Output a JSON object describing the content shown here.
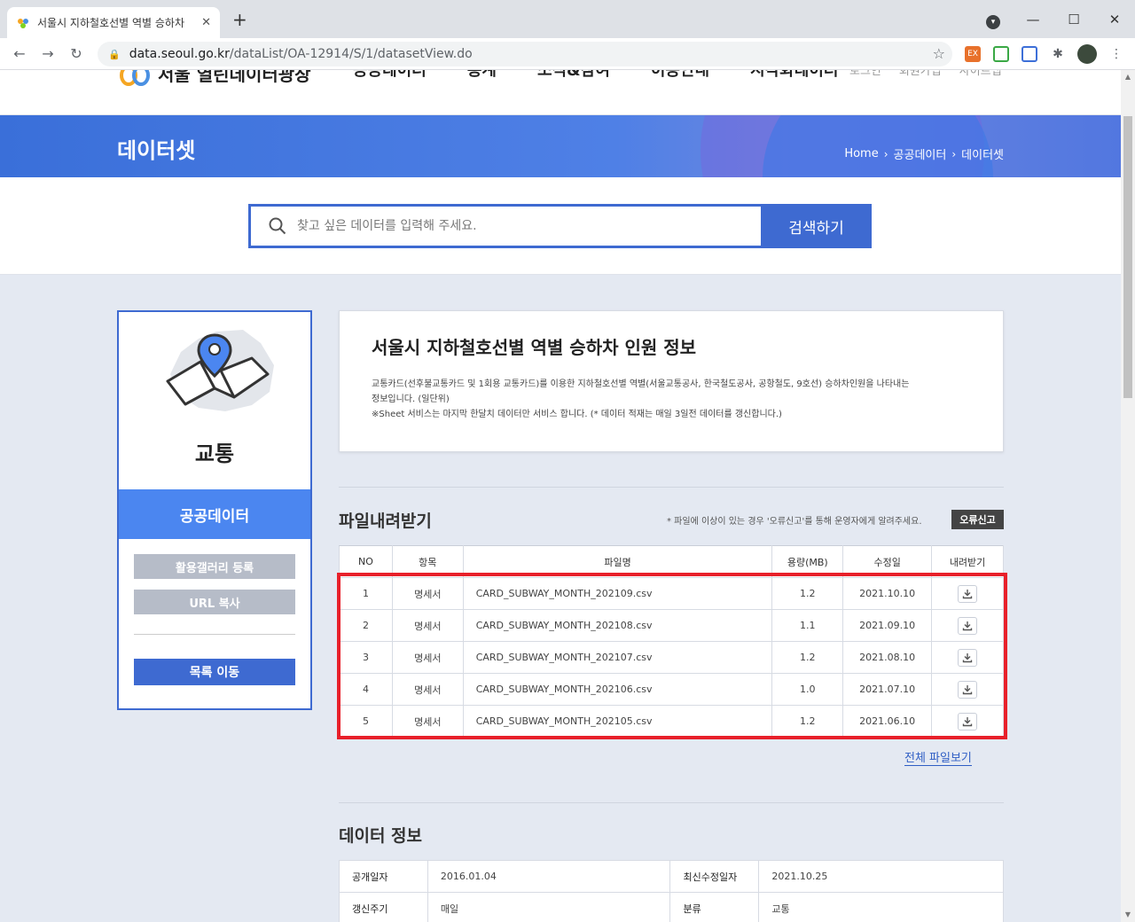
{
  "browser": {
    "tab_title": "서울시 지하철호선별 역별 승하차",
    "url_host": "data.seoul.go.kr",
    "url_path": "/dataList/OA-12914/S/1/datasetView.do"
  },
  "header": {
    "logo_text": "서울 열린데이터광장",
    "nav": [
      "공공데이터",
      "통계",
      "소식&참여",
      "이용안내",
      "시각화데이터"
    ],
    "util": [
      "로그인",
      "회원가입",
      "사이트맵"
    ]
  },
  "banner": {
    "title": "데이터셋",
    "breadcrumb": [
      "Home",
      "공공데이터",
      "데이터셋"
    ]
  },
  "search": {
    "placeholder": "찾고 싶은 데이터를 입력해 주세요.",
    "button": "검색하기"
  },
  "sidebar": {
    "category": "교통",
    "section": "공공데이터",
    "gallery_button": "활용갤러리 등록",
    "url_button": "URL 복사",
    "list_button": "목록 이동"
  },
  "dataset": {
    "title": "서울시 지하철호선별 역별 승하차 인원 정보",
    "description_1": "교통카드(선후불교통카드 및 1회용 교통카드)를 이용한 지하철호선별 역별(서울교통공사, 한국철도공사, 공항철도, 9호선) 승하차인원을 나타내는",
    "description_2": "정보입니다. (일단위)",
    "description_3": "※Sheet 서비스는 마지막 한달치 데이터만 서비스 합니다. (* 데이터 적재는 매일 3일전 데이터를 갱신합니다.)"
  },
  "downloads": {
    "title": "파일내려받기",
    "notice": "* 파일에 이상이 있는 경우 '오류신고'를 통해 운영자에게 알려주세요.",
    "report_button": "오류신고",
    "columns": [
      "NO",
      "항목",
      "파일명",
      "용량(MB)",
      "수정일",
      "내려받기"
    ],
    "rows": [
      {
        "no": "1",
        "type": "명세서",
        "file": "CARD_SUBWAY_MONTH_202109.csv",
        "size": "1.2",
        "date": "2021.10.10"
      },
      {
        "no": "2",
        "type": "명세서",
        "file": "CARD_SUBWAY_MONTH_202108.csv",
        "size": "1.1",
        "date": "2021.09.10"
      },
      {
        "no": "3",
        "type": "명세서",
        "file": "CARD_SUBWAY_MONTH_202107.csv",
        "size": "1.2",
        "date": "2021.08.10"
      },
      {
        "no": "4",
        "type": "명세서",
        "file": "CARD_SUBWAY_MONTH_202106.csv",
        "size": "1.0",
        "date": "2021.07.10"
      },
      {
        "no": "5",
        "type": "명세서",
        "file": "CARD_SUBWAY_MONTH_202105.csv",
        "size": "1.2",
        "date": "2021.06.10"
      }
    ],
    "view_all": "전체 파일보기"
  },
  "info": {
    "title": "데이터 정보",
    "rows": [
      {
        "k1": "공개일자",
        "v1": "2016.01.04",
        "k2": "최신수정일자",
        "v2": "2021.10.25"
      },
      {
        "k1": "갱신주기",
        "v1": "매일",
        "k2": "분류",
        "v2": "교통"
      }
    ]
  },
  "colors": {
    "primary": "#3e6ad1",
    "highlight": "#e8202a",
    "sidebar_section": "#4b86f0"
  }
}
